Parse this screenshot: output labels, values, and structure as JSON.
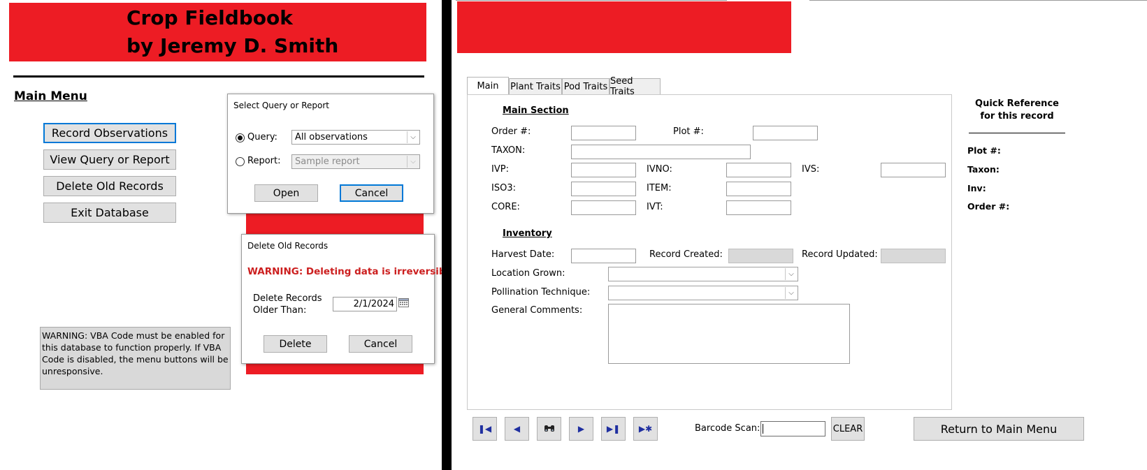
{
  "menu_form": {
    "title_line1": "Crop Fieldbook",
    "title_line2": "by Jeremy D. Smith",
    "heading": "Main Menu",
    "buttons": [
      "Record Observations",
      "View Query or Report",
      "Delete Old Records",
      "Exit Database"
    ],
    "warning": "WARNING: VBA Code must be enabled for this database to function properly. If VBA Code is disabled, the menu buttons will be unresponsive."
  },
  "query_dialog": {
    "title": "Select Query or Report",
    "query_label": "Query:",
    "query_value": "All observations",
    "report_label": "Report:",
    "report_value": "Sample report",
    "selected": "query",
    "open_label": "Open",
    "cancel_label": "Cancel"
  },
  "delete_dialog": {
    "title": "Delete Old Records",
    "warning": "WARNING: Deleting data is irreversible!",
    "field_label_line1": "Delete Records",
    "field_label_line2": "Older Than:",
    "date_value": "2/1/2024",
    "delete_label": "Delete",
    "cancel_label": "Cancel"
  },
  "record_form": {
    "tabs": [
      "Main",
      "Plant Traits",
      "Pod Traits",
      "Seed Traits"
    ],
    "active_tab": "Main",
    "main_section": {
      "heading": "Main Section",
      "order_label": "Order #:",
      "plot_label": "Plot #:",
      "taxon_label": "TAXON:",
      "ivp_label": "IVP:",
      "ivno_label": "IVNO:",
      "ivs_label": "IVS:",
      "iso3_label": "ISO3:",
      "item_label": "ITEM:",
      "core_label": "CORE:",
      "ivt_label": "IVT:"
    },
    "inventory": {
      "heading": "Inventory",
      "harvest_label": "Harvest Date:",
      "created_label": "Record Created:",
      "updated_label": "Record Updated:",
      "location_label": "Location Grown:",
      "pollination_label": "Pollination Technique:",
      "comments_label": "General Comments:"
    },
    "quick_ref": {
      "title_line1": "Quick Reference",
      "title_line2": "for this record",
      "items": [
        "Plot #:",
        "Taxon:",
        "Inv:",
        "Order #:"
      ]
    },
    "nav_icons": [
      "first-record-icon",
      "previous-record-icon",
      "find-icon",
      "next-record-icon",
      "last-record-icon",
      "new-record-icon"
    ],
    "barcode_label": "Barcode Scan:",
    "barcode_value": "",
    "clear_label": "CLEAR",
    "return_label": "Return to Main Menu"
  },
  "colors": {
    "brand_red": "#ed1c24",
    "warning_red": "#cc1f1f",
    "focus_blue": "#0078d7",
    "panel_gray": "#d9d9d9"
  }
}
